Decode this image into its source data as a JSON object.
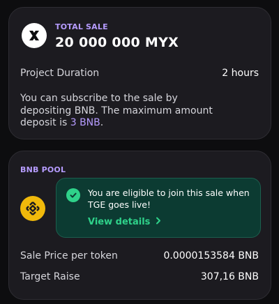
{
  "sale": {
    "label": "TOTAL SALE",
    "amount": "20 000 000 MYX",
    "duration_label": "Project Duration",
    "duration_value": "2 hours",
    "description_prefix": "You can subscribe to the sale by depositing BNB. The maximum amount deposit is ",
    "description_highlight": "3 BNB",
    "description_suffix": ".",
    "logo_icon": "myx-x-logo-icon"
  },
  "pool": {
    "label": "BNB POOL",
    "coin_icon": "bnb-coin-icon",
    "notice_text": "You are eligible to join this sale when TGE goes live!",
    "notice_link": "View details",
    "price_label": "Sale Price per token",
    "price_value": "0.0000153584 BNB",
    "raise_label": "Target Raise",
    "raise_value": "307,16 BNB"
  },
  "colors": {
    "accent_purple": "#b69cff",
    "success_green": "#2fd28a",
    "notice_bg": "#0c3b32",
    "bnb_yellow": "#f0b90b"
  }
}
